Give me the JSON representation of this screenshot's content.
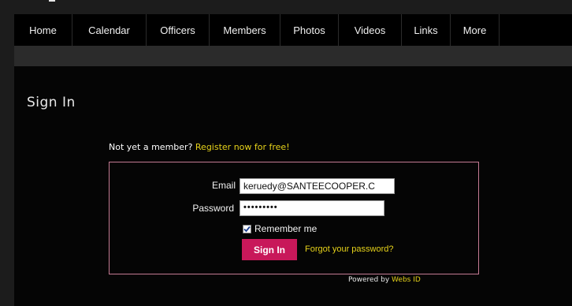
{
  "nav": {
    "items": [
      {
        "label": "Home"
      },
      {
        "label": "Calendar"
      },
      {
        "label": "Officers"
      },
      {
        "label": "Members"
      },
      {
        "label": "Photos"
      },
      {
        "label": "Videos"
      },
      {
        "label": "Links"
      },
      {
        "label": "More"
      }
    ]
  },
  "page": {
    "title": "Sign In"
  },
  "register": {
    "prompt": "Not yet a member?",
    "link_label": "Register now for free!"
  },
  "form": {
    "email_label": "Email",
    "email_value": "keruedy@SANTEECOOPER.C",
    "password_label": "Password",
    "password_mask": "•••••••••",
    "remember_label": "Remember me",
    "remember_checked": true,
    "signin_label": "Sign In",
    "forgot_label": "Forgot your password?"
  },
  "footer": {
    "powered_prefix": "Powered by",
    "powered_brand": "Webs ID"
  },
  "colors": {
    "accent": "#c8185a",
    "link": "#e6d21a",
    "box_border": "#c47a93"
  }
}
